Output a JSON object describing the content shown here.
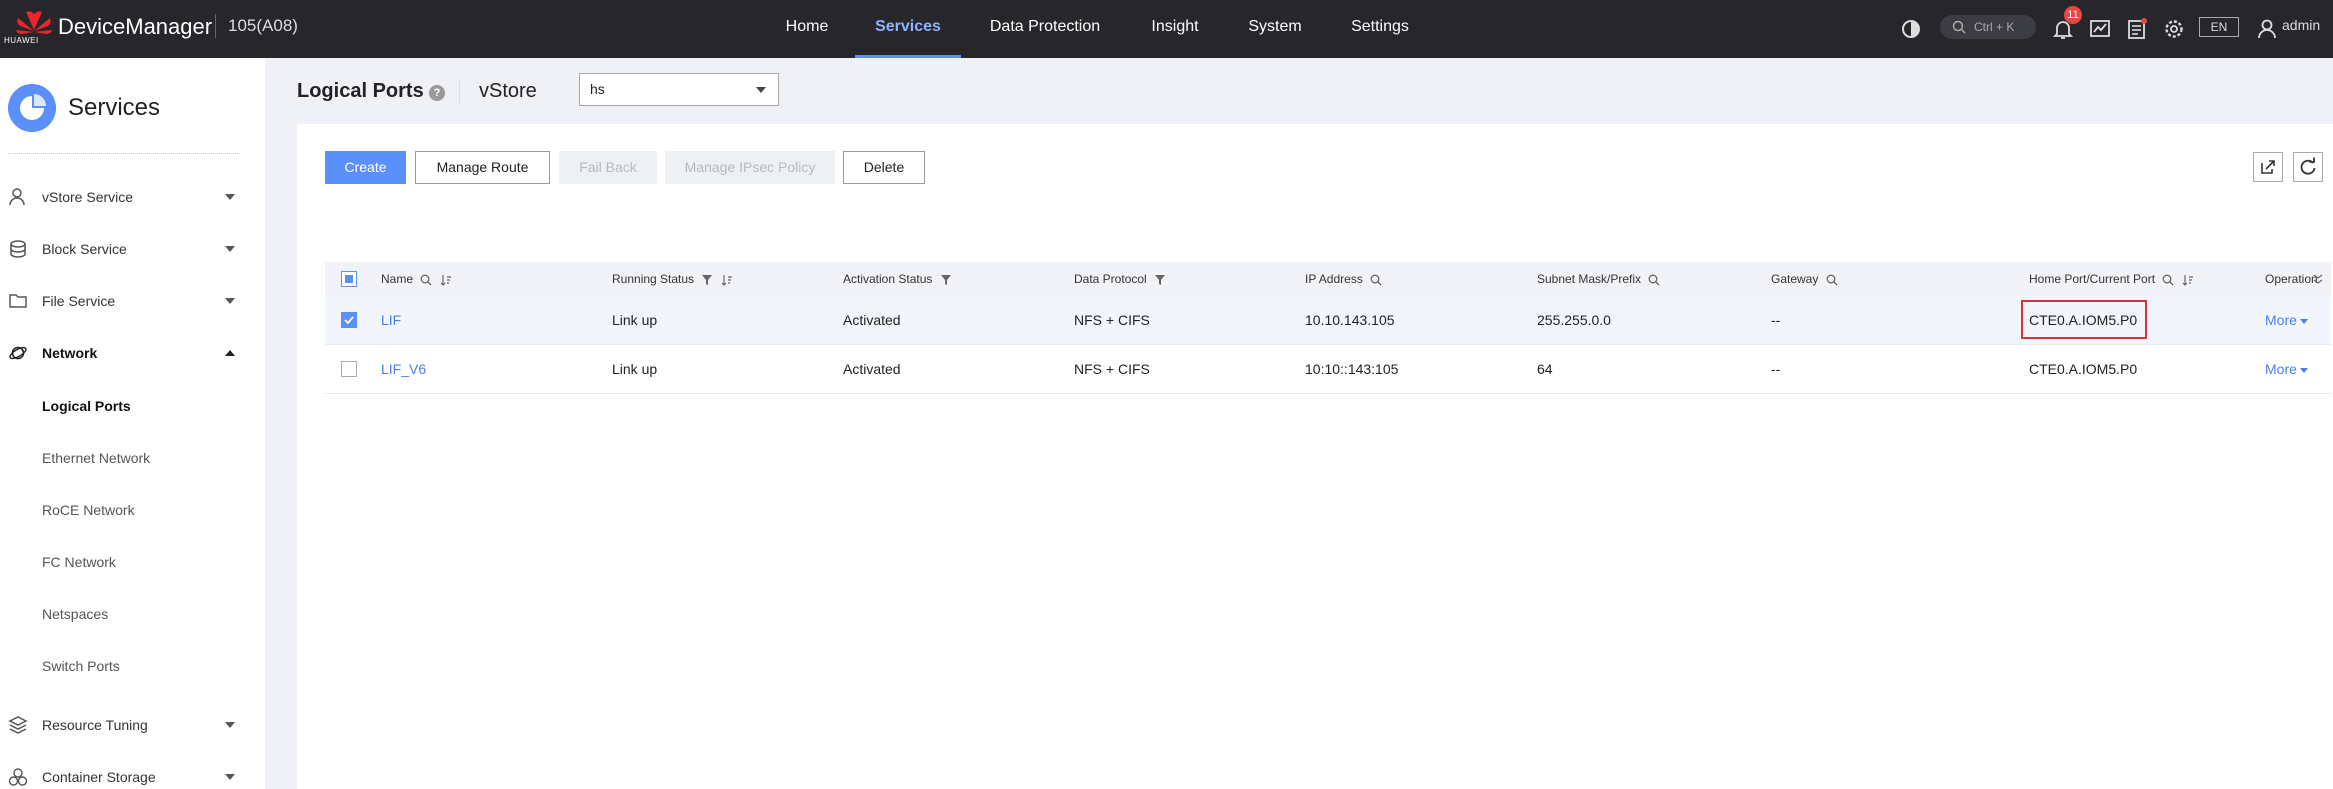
{
  "topbar": {
    "brand": "HUAWEI",
    "app_title": "DeviceManager",
    "device": "105(A08)",
    "nav": [
      "Home",
      "Services",
      "Data Protection",
      "Insight",
      "System",
      "Settings"
    ],
    "search_shortcut": "Ctrl + K",
    "notification_count": "11",
    "language": "EN",
    "user": "admin"
  },
  "sidebar": {
    "title": "Services",
    "items": [
      {
        "label": "vStore Service",
        "icon": "user-icon"
      },
      {
        "label": "Block Service",
        "icon": "database-icon"
      },
      {
        "label": "File Service",
        "icon": "folder-icon"
      },
      {
        "label": "Network",
        "icon": "planet-icon"
      },
      {
        "label": "Resource Tuning",
        "icon": "layers-icon"
      },
      {
        "label": "Container Storage",
        "icon": "cluster-icon"
      }
    ],
    "network_sub": [
      "Logical Ports",
      "Ethernet Network",
      "RoCE Network",
      "FC Network",
      "Netspaces",
      "Switch Ports"
    ]
  },
  "page": {
    "title": "Logical Ports",
    "help": "?",
    "vstore_label": "vStore",
    "vstore_value": "hs"
  },
  "toolbar": {
    "create": "Create",
    "manage_route": "Manage Route",
    "fail_back": "Fail Back",
    "manage_ipsec": "Manage IPsec Policy",
    "delete": "Delete"
  },
  "table": {
    "columns": [
      "Name",
      "Running Status",
      "Activation Status",
      "Data Protocol",
      "IP Address",
      "Subnet Mask/Prefix",
      "Gateway",
      "Home Port/Current Port",
      "Operation"
    ],
    "rows": [
      {
        "name": "LIF",
        "running": "Link up",
        "activation": "Activated",
        "protocol": "NFS + CIFS",
        "ip": "10.10.143.105",
        "mask": "255.255.0.0",
        "gateway": "--",
        "port": "CTE0.A.IOM5.P0",
        "op": "More"
      },
      {
        "name": "LIF_V6",
        "running": "Link up",
        "activation": "Activated",
        "protocol": "NFS + CIFS",
        "ip": "10:10::143:105",
        "mask": "64",
        "gateway": "--",
        "port": "CTE0.A.IOM5.P0",
        "op": "More"
      }
    ]
  },
  "colors": {
    "accent": "#5b8ff9",
    "topbar": "#26262b",
    "highlight": "#d9303b",
    "badge": "#e84545"
  }
}
